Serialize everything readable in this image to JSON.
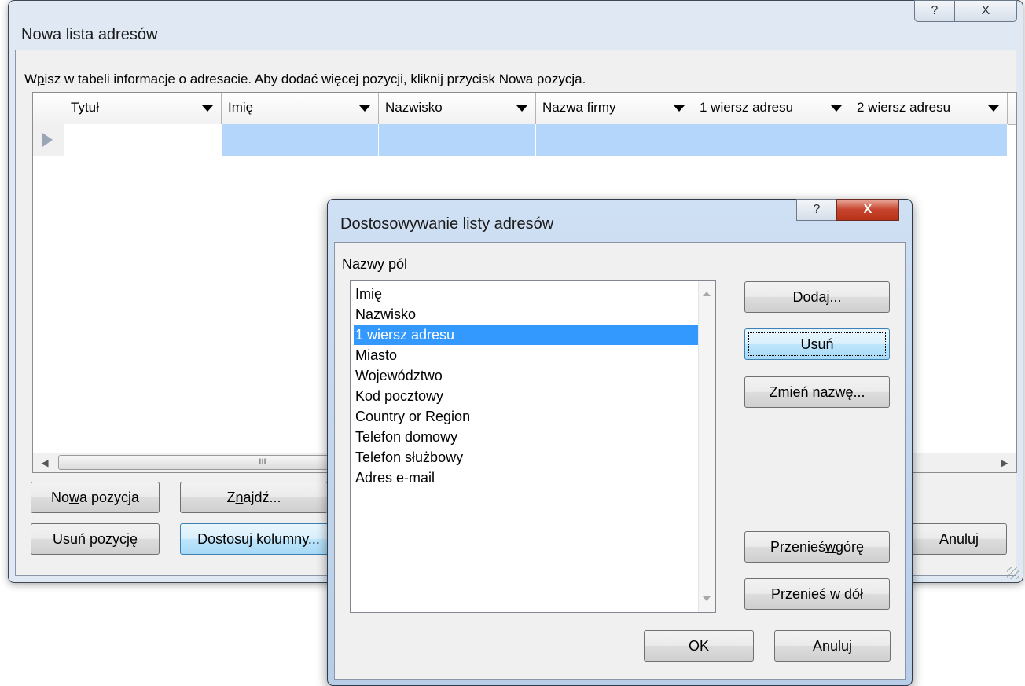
{
  "main_window": {
    "title": "Nowa lista adresów",
    "help_glyph": "?",
    "close_glyph": "X",
    "instruction_pre": "W",
    "instruction_ul": "p",
    "instruction_post": "isz w tabeli informacje o adresacie. Aby dodać więcej pozycji, kliknij przycisk Nowa pozycja.",
    "columns": [
      "Tytuł",
      "Imię",
      "Nazwisko",
      "Nazwa firmy",
      "1 wiersz adresu",
      "2 wiersz adresu"
    ],
    "hscroll_left": "◀",
    "hscroll_thumb": "III",
    "hscroll_right": "▶",
    "new_entry": {
      "pre": "No",
      "ul": "w",
      "post": "a pozycja"
    },
    "find": {
      "pre": "Z",
      "ul": "n",
      "post": "ajdź..."
    },
    "delete_entry": {
      "pre": "U",
      "ul": "s",
      "post": "uń pozycję"
    },
    "customize_columns": {
      "pre": "Dostos",
      "ul": "u",
      "post": "j kolumny..."
    },
    "cancel": "Anuluj"
  },
  "dialog": {
    "title": "Dostosowywanie listy adresów",
    "help_glyph": "?",
    "close_glyph": "X",
    "fields_label": {
      "ul": "N",
      "post": "azwy pól"
    },
    "fields": [
      "Imię",
      "Nazwisko",
      "1 wiersz adresu",
      "Miasto",
      "Województwo",
      "Kod pocztowy",
      "Country or Region",
      "Telefon domowy",
      "Telefon służbowy",
      "Adres e-mail"
    ],
    "selected_field": "1 wiersz adresu",
    "add": {
      "ul": "D",
      "post": "odaj..."
    },
    "delete": {
      "ul": "U",
      "post": "suń"
    },
    "rename": {
      "ul": "Z",
      "post": "mień nazwę..."
    },
    "move_up": {
      "pre": "Przenieś ",
      "ul": "w",
      "post": " górę"
    },
    "move_down": {
      "pre": "P",
      "ul": "r",
      "post": "zenieś w dół"
    },
    "ok": "OK",
    "cancel": "Anuluj"
  }
}
